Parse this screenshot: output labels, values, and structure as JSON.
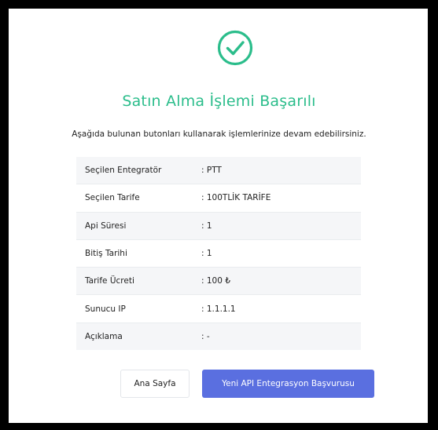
{
  "title": "Satın Alma İşlemi Başarılı",
  "subtitle": "Aşağıda bulunan butonları kullanarak işlemlerinize devam edebilirsiniz.",
  "status_icon": "check-circle-icon",
  "accent_color": "#2bbd8b",
  "details": [
    {
      "label": "Seçilen Entegratör",
      "value": ": PTT"
    },
    {
      "label": "Seçilen Tarife",
      "value": ": 100TLİK TARİFE"
    },
    {
      "label": "Api Süresi",
      "value": ": 1"
    },
    {
      "label": "Bitiş Tarihi",
      "value": ": 1"
    },
    {
      "label": "Tarife Ücreti",
      "value": ": 100 ₺"
    },
    {
      "label": "Sunucu IP",
      "value": ": 1.1.1.1"
    },
    {
      "label": "Açıklama",
      "value": ": -"
    }
  ],
  "buttons": {
    "home_label": "Ana Sayfa",
    "apply_label": "Yeni API Entegrasyon Başvurusu",
    "apply_color": "#5a6fe0"
  }
}
